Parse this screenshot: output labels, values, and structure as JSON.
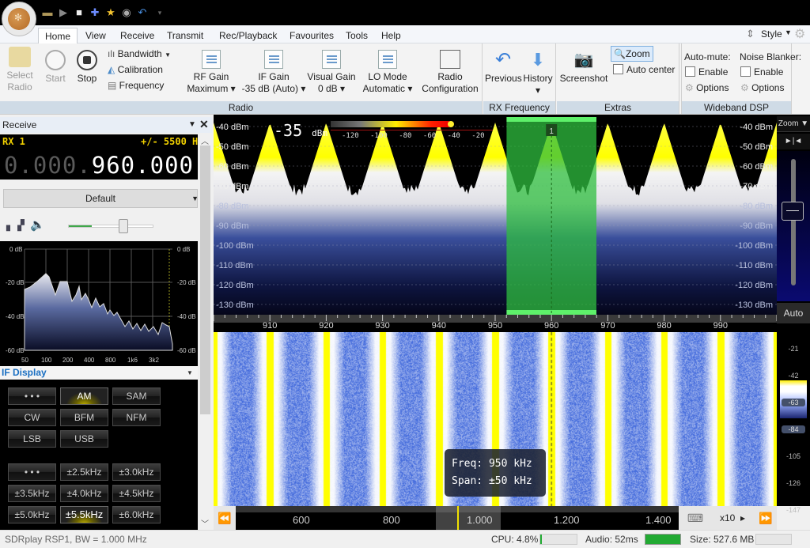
{
  "quick_access": [
    "folder-icon",
    "play-icon",
    "stop-icon",
    "add-icon",
    "favourite-star-icon",
    "camera-icon",
    "undo-icon",
    "dropdown-icon"
  ],
  "menu": {
    "tabs": [
      "Home",
      "View",
      "Receive",
      "Transmit",
      "Rec/Playback",
      "Favourites",
      "Tools",
      "Help"
    ],
    "active": "Home",
    "style_label": "Style"
  },
  "ribbon": {
    "radio_group": {
      "label": "Radio",
      "select_radio": [
        "Select",
        "Radio"
      ],
      "start": "Start",
      "stop": "Stop",
      "bandwidth": "Bandwidth",
      "calibration": "Calibration",
      "frequency": "Frequency",
      "rf_gain": {
        "label": "RF Gain",
        "value": "Maximum"
      },
      "if_gain": {
        "label": "IF Gain",
        "value": "-35 dB (Auto)"
      },
      "visual_gain": {
        "label": "Visual Gain",
        "value": "0 dB"
      },
      "lo_mode": {
        "label": "LO Mode",
        "value": "Automatic"
      },
      "radio_config": [
        "Radio",
        "Configuration"
      ]
    },
    "rx_frequency_group": {
      "label": "RX Frequency",
      "previous": "Previous",
      "history": "History"
    },
    "extras_group": {
      "label": "Extras",
      "screenshot": "Screenshot",
      "zoom": "Zoom",
      "auto_center": "Auto center",
      "auto_center_checked": false
    },
    "wideband_dsp_group": {
      "label": "Wideband DSP",
      "auto_mute": {
        "title": "Auto-mute:",
        "enable": "Enable",
        "enabled": false,
        "options": "Options"
      },
      "noise_blanker": {
        "title": "Noise Blanker:",
        "enable": "Enable",
        "enabled": false,
        "options": "Options"
      }
    }
  },
  "receive_panel": {
    "title": "Receive",
    "rx_label": "RX 1",
    "bandwidth_readout": "+/- 5500 H",
    "frequency_dim": "0.000.",
    "frequency_bright": "960.000",
    "profile": "Default",
    "volume_fraction": 0.45,
    "audio_spectrum": {
      "y_labels": [
        "0 dB",
        "-20 dB",
        "-40 dB",
        "-60 dB"
      ],
      "x_labels": [
        "50",
        "100",
        "200",
        "400",
        "800",
        "1k6",
        "3k2"
      ]
    }
  },
  "if_display": {
    "title": "IF Display",
    "modes": [
      "• • •",
      "AM",
      "SAM",
      "CW",
      "BFM",
      "NFM",
      "LSB",
      "USB"
    ],
    "selected_mode": "AM",
    "bandwidths": [
      "• • •",
      "±2.5kHz",
      "±3.0kHz",
      "±3.5kHz",
      "±4.0kHz",
      "±4.5kHz",
      "±5.0kHz",
      "±5.5kHz",
      "±6.0kHz"
    ],
    "selected_bandwidth": "±5.5kHz"
  },
  "spectrum": {
    "signal_level": "-35",
    "signal_unit": "dBm",
    "meter_scale": [
      "-120",
      "-100",
      "-80",
      "-60",
      "-40",
      "-20"
    ],
    "meter_level_dbm": -35,
    "db_labels": [
      "-40 dBm",
      "-50 dBm",
      "-60 dBm",
      "-70 dBm",
      "-80 dBm",
      "-90 dBm",
      "-100 dBm",
      "-110 dBm",
      "-120 dBm",
      "-130 dBm"
    ],
    "freq_axis": [
      "910",
      "920",
      "930",
      "940",
      "950",
      "960",
      "970",
      "980",
      "990"
    ],
    "freq_range_khz": [
      900,
      1000
    ],
    "vfo_marker": "1",
    "vfo_khz": 960,
    "carriers_khz": [
      900,
      910,
      920,
      930,
      940,
      950,
      960,
      970,
      980,
      990,
      1000
    ],
    "zoom_label": "Zoom",
    "auto_label": "Auto"
  },
  "waterfall": {
    "tooltip_freq": "Freq: 950 kHz",
    "tooltip_span": "Span: ±50 kHz",
    "color_scale": [
      "-21",
      "-42",
      "-63",
      "-84",
      "-105",
      "-126",
      "-147"
    ]
  },
  "overview_scroller": {
    "labels": [
      "600",
      "800",
      "1.000",
      "1.200",
      "1.400"
    ],
    "zoom_factor": "x10"
  },
  "status_bar": {
    "device": "SDRplay RSP1, BW = 1.000 MHz",
    "cpu": "CPU: 4.8%",
    "cpu_fraction": 0.048,
    "audio": "Audio: 52ms",
    "size": "Size: 527.6 MB"
  },
  "colors": {
    "accent_blue": "#1a6fc2",
    "vfo_green": "#2fcf3f",
    "carrier_yellow": "#ffff00",
    "readout_yellow": "#f0d000"
  }
}
